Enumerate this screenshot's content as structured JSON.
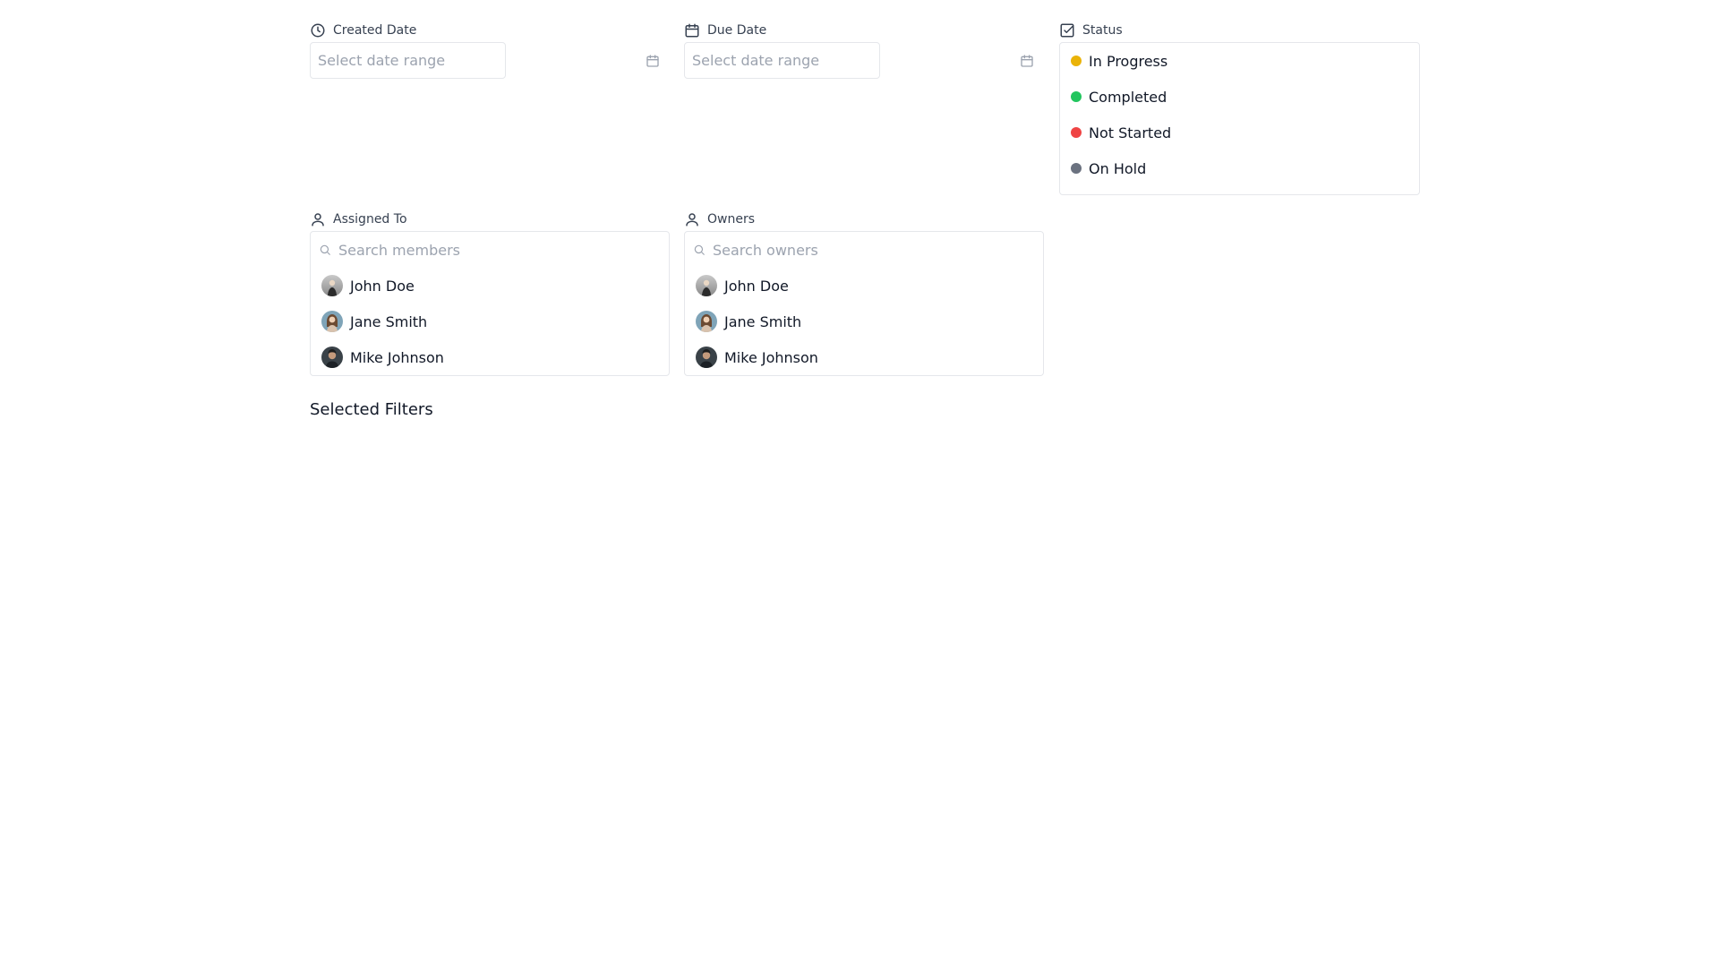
{
  "filters": {
    "created_date": {
      "label": "Created Date",
      "icon": "clock-icon",
      "placeholder": "Select date range"
    },
    "due_date": {
      "label": "Due Date",
      "icon": "calendar-icon",
      "placeholder": "Select date range"
    },
    "status": {
      "label": "Status",
      "icon": "checkbox-icon",
      "items": [
        {
          "label": "In Progress",
          "color": "#eab308"
        },
        {
          "label": "Completed",
          "color": "#22c55e"
        },
        {
          "label": "Not Started",
          "color": "#ef4444"
        },
        {
          "label": "On Hold",
          "color": "#6b7280"
        }
      ]
    },
    "assigned_to": {
      "label": "Assigned To",
      "icon": "user-icon",
      "search_placeholder": "Search members",
      "members": [
        {
          "name": "John Doe"
        },
        {
          "name": "Jane Smith"
        },
        {
          "name": "Mike Johnson"
        }
      ]
    },
    "owners": {
      "label": "Owners",
      "icon": "user-icon",
      "search_placeholder": "Search owners",
      "members": [
        {
          "name": "John Doe"
        },
        {
          "name": "Jane Smith"
        },
        {
          "name": "Mike Johnson"
        }
      ]
    }
  },
  "selected_filters": {
    "title": "Selected Filters"
  }
}
